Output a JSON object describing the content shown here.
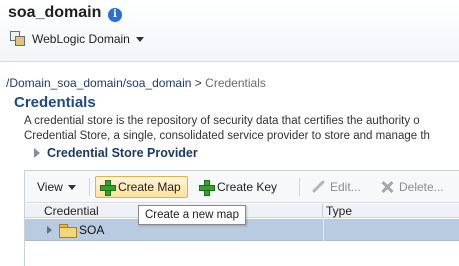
{
  "header": {
    "domain_title": "soa_domain",
    "info_icon_glyph": "i",
    "weblogic_menu_label": "WebLogic Domain"
  },
  "breadcrumb": {
    "path_link": "/Domain_soa_domain/soa_domain",
    "separator": ">",
    "current": "Credentials"
  },
  "page": {
    "title": "Credentials",
    "description_line1": "A credential store is the repository of security data that certifies the authority o",
    "description_line2": "Credential Store, a single, consolidated service provider to store and manage th",
    "provider_label": "Credential Store Provider"
  },
  "toolbar": {
    "view_label": "View",
    "create_map_label": "Create Map",
    "create_key_label": "Create Key",
    "edit_label": "Edit...",
    "delete_label": "Delete..."
  },
  "tooltip": {
    "text": "Create a new map"
  },
  "table": {
    "columns": [
      "Credential",
      "Type"
    ],
    "rows": [
      {
        "credential": "SOA",
        "type": ""
      }
    ]
  },
  "colors": {
    "title_blue": "#1b4a86",
    "selected_row": "#b9cbe1",
    "create_map_highlight": "#ffe29b"
  }
}
